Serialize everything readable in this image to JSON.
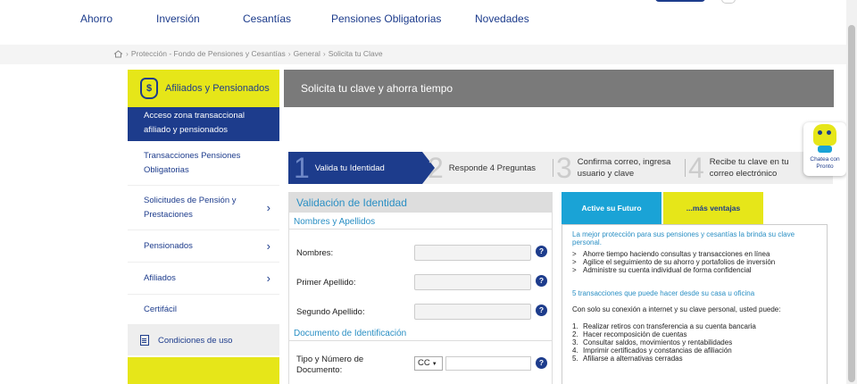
{
  "nav": {
    "items": [
      "Ahorro",
      "Inversión",
      "Cesantías",
      "Pensiones Obligatorias",
      "Novedades"
    ]
  },
  "breadcrumb": [
    "Protección - Fondo de Pensiones y Cesantías",
    "General",
    "Solicita tu Clave"
  ],
  "sidebar": {
    "header": "Afiliados y Pensionados",
    "active": [
      "Acceso zona transaccional",
      "afiliado y pensionados"
    ],
    "items": [
      {
        "label": [
          "Transacciones Pensiones",
          "Obligatorias"
        ],
        "chevron": false
      },
      {
        "label": [
          "Solicitudes de Pensión y",
          "Prestaciones"
        ],
        "chevron": true
      },
      {
        "label": [
          "Pensionados"
        ],
        "chevron": true
      },
      {
        "label": [
          "Afiliados"
        ],
        "chevron": true
      },
      {
        "label": [
          "Certifácil"
        ],
        "chevron": false
      }
    ],
    "conditions": "Condiciones de uso"
  },
  "banner": {
    "title": "Solicita tu clave y ahorra tiempo"
  },
  "steps": [
    {
      "num": "1",
      "label": "Valida tu Identidad"
    },
    {
      "num": "2",
      "label": "Responde 4 Preguntas"
    },
    {
      "num": "3",
      "label": [
        "Confirma correo, ingresa",
        "usuario y clave"
      ]
    },
    {
      "num": "4",
      "label": [
        "Recibe tu clave en tu",
        "correo electrónico"
      ]
    }
  ],
  "form": {
    "title": "Validación de Identidad",
    "section_names": "Nombres y Apellidos",
    "fields": {
      "nombres": "Nombres:",
      "primer_apellido": "Primer Apellido:",
      "segundo_apellido": "Segundo Apellido:"
    },
    "section_doc": "Documento de Identificación",
    "doc_label": [
      "Tipo y Número de",
      "Documento:"
    ],
    "doc_type": "CC",
    "help_glyph": "?"
  },
  "info": {
    "tabs": [
      "Active su Futuro",
      "...más ventajas"
    ],
    "intro": [
      "La mejor protección para sus pensiones y cesantías la brinda su clave",
      "personal."
    ],
    "bullets": [
      "Ahorre tiempo haciendo consultas y transacciones en línea",
      "Agilice el seguimiento de su ahorro y portafolios de inversión",
      "Administre su cuenta individual de forma confidencial"
    ],
    "transactions_title": "5 transacciones que puede hacer desde su casa u oficina",
    "transactions_intro": "Con solo su conexión a internet y su clave personal, usted puede:",
    "transactions": [
      "Realizar retiros con transferencia a su cuenta bancaria",
      "Hacer recomposición de cuentas",
      "Consultar saldos, movimientos y rentabilidades",
      "Imprimir certificados y constancias de afiliación",
      "Afiliarse a alternativas cerradas"
    ]
  },
  "chat": [
    "Chatea con",
    "Pronto"
  ]
}
